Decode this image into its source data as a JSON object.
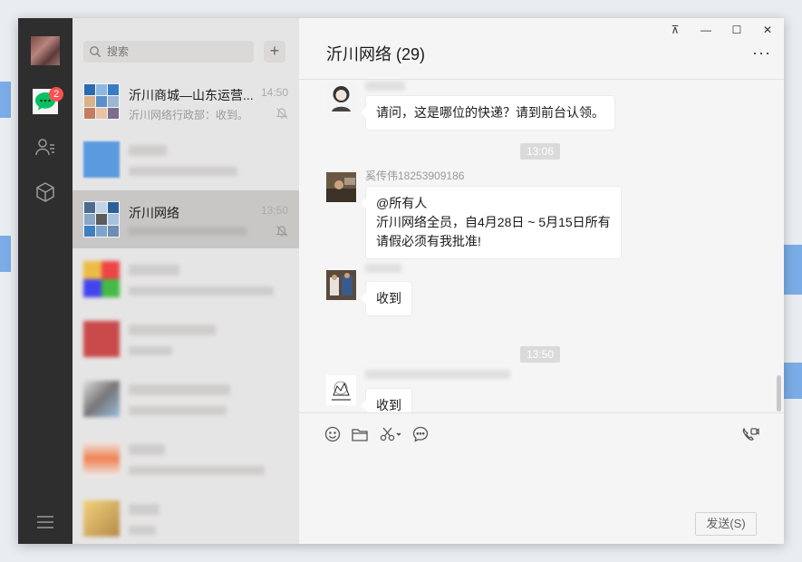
{
  "nav": {
    "badge_count": "2",
    "icons": [
      "chat-icon",
      "contacts-icon",
      "favorites-icon",
      "menu-icon"
    ],
    "accent": "#07c160"
  },
  "search": {
    "placeholder": "搜索",
    "add_label": "+"
  },
  "sessions": [
    {
      "name": "沂川商城—山东运营...",
      "time": "14:50",
      "preview": "沂川网络行政部：收到。",
      "muted": true
    },
    {
      "name": "沂川网络",
      "time": "13:50",
      "preview": "",
      "muted": true,
      "selected": true
    }
  ],
  "chat": {
    "title": "沂川网络 (29)",
    "more": "···",
    "messages": [
      {
        "text": "请问，这是哪位的快递？请到前台认领。"
      },
      {
        "time": "13:06"
      },
      {
        "sender": "奚传伟18253909186",
        "lines": [
          "@所有人",
          "沂川网络全员，自4月28日 ~ 5月15日所有",
          "请假必须有我批准!"
        ]
      },
      {
        "text": "收到"
      },
      {
        "time": "13:50"
      },
      {
        "text": "收到"
      }
    ],
    "send_label": "发送(S)"
  },
  "window_controls": {
    "pin": "⊼",
    "minimize": "—",
    "maximize": "☐",
    "close": "✕"
  }
}
